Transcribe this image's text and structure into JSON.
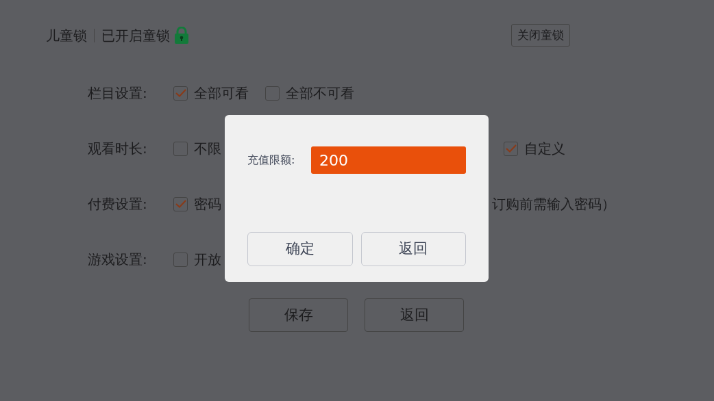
{
  "header": {
    "title": "儿童锁",
    "status": "已开启童锁",
    "locked": true,
    "button": "关闭童锁"
  },
  "settings": [
    {
      "label": "栏目设置:",
      "options": [
        {
          "label": "全部可看",
          "checked": true
        },
        {
          "label": "全部不可看",
          "checked": false
        }
      ]
    },
    {
      "label": "观看时长:",
      "options": [
        {
          "label": "不限",
          "checked": false
        }
      ],
      "right_options": [
        {
          "label": "自定义",
          "checked": true
        }
      ]
    },
    {
      "label": "付费设置:",
      "options": [
        {
          "label": "密码",
          "checked": true
        }
      ],
      "right_text": "订购前需输入密码）"
    },
    {
      "label": "游戏设置:",
      "options": [
        {
          "label": "开放",
          "checked": false
        }
      ]
    }
  ],
  "buttons": [
    "保存",
    "返回"
  ],
  "dialog": {
    "field_label": "充值限额:",
    "value": "200",
    "buttons": [
      "确定",
      "返回"
    ]
  }
}
